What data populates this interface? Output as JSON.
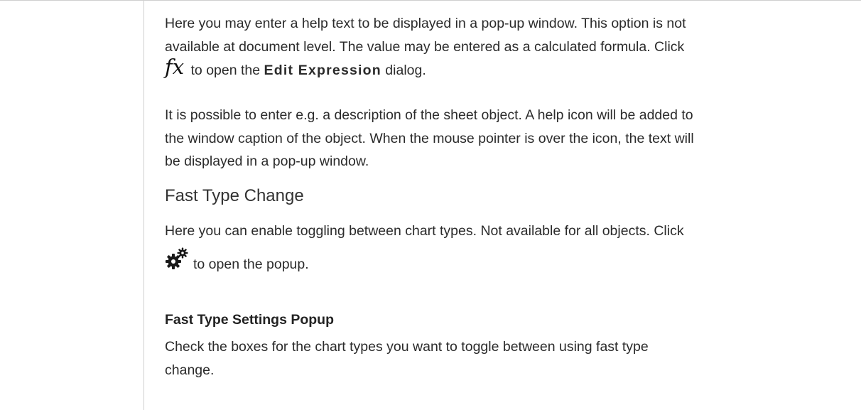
{
  "help_text": {
    "para1_line1": "Here you may enter a help text to be displayed in a pop-up window. This option is not",
    "para1_line2": "available at document level. The value may be entered as a calculated formula. Click",
    "fx_symbol": "fx",
    "para1_line3_before": " to open the ",
    "para1_line3_bold": "Edit Expression",
    "para1_line3_after": " dialog.",
    "para2_line1": "It is possible to enter e.g. a description of the sheet object. A help icon will be added to",
    "para2_line2": "the window caption of the object. When the mouse pointer is over the icon, the text will",
    "para2_line3": "be displayed in a pop-up window."
  },
  "fast_type": {
    "heading": "Fast Type Change",
    "para_line1": "Here you can enable toggling between chart types. Not available for all objects. Click",
    "gear_icon": "gear-icon",
    "para_line2": "to open the popup."
  },
  "popup": {
    "subheading": "Fast Type Settings Popup",
    "para_line1": "Check the boxes for the chart types you want to toggle between using fast type",
    "para_line2": "change."
  }
}
